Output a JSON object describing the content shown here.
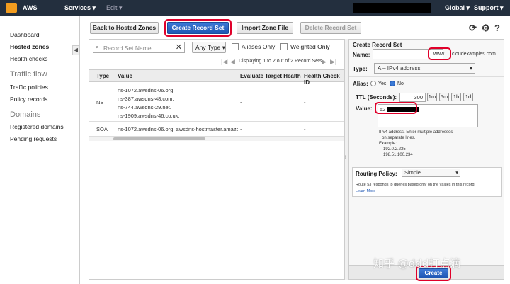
{
  "topbar": {
    "brand": "AWS",
    "services": "Services",
    "edit": "Edit",
    "region": "Global",
    "support": "Support"
  },
  "sidebar": {
    "items": [
      "Dashboard",
      "Hosted zones",
      "Health checks"
    ],
    "traffic_flow_header": "Traffic flow",
    "traffic_flow_items": [
      "Traffic policies",
      "Policy records"
    ],
    "domains_header": "Domains",
    "domains_items": [
      "Registered domains",
      "Pending requests"
    ]
  },
  "toolbar": {
    "back": "Back to Hosted Zones",
    "create": "Create Record Set",
    "import": "Import Zone File",
    "delete": "Delete Record Set"
  },
  "filter": {
    "placeholder": "Record Set Name",
    "type": "Any Type",
    "aliases_only": "Aliases Only",
    "weighted_only": "Weighted Only"
  },
  "pager": {
    "text": "Displaying 1 to 2 out of 2 Record Sets"
  },
  "table": {
    "headers": [
      "Type",
      "Value",
      "Evaluate Target Health",
      "Health Check ID"
    ],
    "rows": [
      {
        "type": "NS",
        "values": [
          "ns-1072.awsdns-06.org.",
          "ns-387.awsdns-48.com.",
          "ns-744.awsdns-29.net.",
          "ns-1909.awsdns-46.co.uk."
        ],
        "eval": "-",
        "hc": "-"
      },
      {
        "type": "SOA",
        "values": [
          "ns-1072.awsdns-06.org. awsdns-hostmaster.amazo"
        ],
        "eval": "-",
        "hc": "-"
      }
    ]
  },
  "form": {
    "title": "Create Record Set",
    "name_label": "Name:",
    "name_value": "www",
    "domain_suffix": ".cloudexamples.com.",
    "type_label": "Type:",
    "type_value": "A – IPv4 address",
    "alias_label": "Alias:",
    "alias_yes": "Yes",
    "alias_no": "No",
    "ttl_label": "TTL (Seconds):",
    "ttl_value": "300",
    "ttl_buttons": [
      "1m",
      "5m",
      "1h",
      "1d"
    ],
    "value_label": "Value:",
    "value_prefix": "52",
    "value_help": [
      "IPv4 address. Enter multiple addresses",
      "on separate lines.",
      "Example:",
      "192.0.2.235",
      "198.51.100.234"
    ],
    "routing_label": "Routing Policy:",
    "routing_value": "Simple",
    "routing_help": "Route 53 responds to queries based only on the values in this record.",
    "learn_more": "Learn More",
    "create_button": "Create"
  },
  "watermark": "知乎 @ddd打点滴",
  "colors": {
    "accent": "#1e56b3",
    "highlight": "#e0002a",
    "topbar": "#232f3e"
  }
}
